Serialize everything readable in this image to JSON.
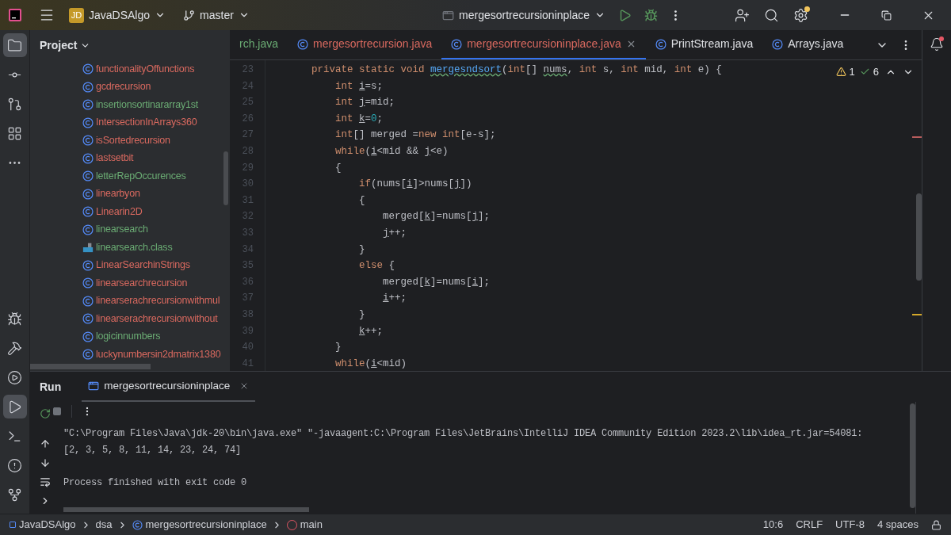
{
  "title_bar": {
    "project_badge": "JD",
    "project": "JavaDSAlgo",
    "branch": "master",
    "run_config": "mergesortrecursioninplace"
  },
  "project_panel": {
    "title": "Project",
    "items": [
      {
        "name": "functionalityOffunctions",
        "kind": "class",
        "color": "#d9695f"
      },
      {
        "name": "gcdrecursion",
        "kind": "class",
        "color": "#d9695f"
      },
      {
        "name": "insertionsortinararray1st",
        "kind": "class",
        "color": "#6aab73"
      },
      {
        "name": "IntersectionInArrays360",
        "kind": "class",
        "color": "#d9695f"
      },
      {
        "name": "isSortedrecursion",
        "kind": "class",
        "color": "#d9695f"
      },
      {
        "name": "lastsetbit",
        "kind": "class",
        "color": "#d9695f"
      },
      {
        "name": "letterRepOccurences",
        "kind": "class",
        "color": "#6aab73"
      },
      {
        "name": "linearbyon",
        "kind": "class",
        "color": "#d9695f"
      },
      {
        "name": "Linearin2D",
        "kind": "class",
        "color": "#d9695f"
      },
      {
        "name": "linearsearch",
        "kind": "class",
        "color": "#6aab73"
      },
      {
        "name": "linearsearch.class",
        "kind": "binary",
        "color": "#6aab73"
      },
      {
        "name": "LinearSearchinStrings",
        "kind": "class",
        "color": "#d9695f"
      },
      {
        "name": "linearsearchrecursion",
        "kind": "class",
        "color": "#d9695f"
      },
      {
        "name": "linearserachrecursionwithmul",
        "kind": "class",
        "color": "#d9695f"
      },
      {
        "name": "linearserachrecursionwithout",
        "kind": "class",
        "color": "#d9695f"
      },
      {
        "name": "logicinnumbers",
        "kind": "class",
        "color": "#6aab73"
      },
      {
        "name": "luckynumbersin2dmatrix1380",
        "kind": "class",
        "color": "#d9695f"
      }
    ]
  },
  "tabs": [
    {
      "label": "rch.java",
      "selected": false,
      "icon": false,
      "color": "#6aab73"
    },
    {
      "label": "mergesortrecursion.java",
      "selected": false,
      "icon": true,
      "color": "#d9695f"
    },
    {
      "label": "mergesortrecursioninplace.java",
      "selected": true,
      "icon": true,
      "color": "#d9695f"
    },
    {
      "label": "PrintStream.java",
      "selected": false,
      "icon": true,
      "color": "#dfe1e5"
    },
    {
      "label": "Arrays.java",
      "selected": false,
      "icon": true,
      "color": "#dfe1e5"
    }
  ],
  "editor": {
    "warnings": "1",
    "checks": "6",
    "lines": [
      {
        "number": "23",
        "tokens": [
          {
            "kind": "kw",
            "text": "    private static void "
          },
          {
            "kind": "decl",
            "text": "mergesndsort"
          },
          {
            "kind": "text",
            "text": "("
          },
          {
            "kind": "kw",
            "text": "int"
          },
          {
            "kind": "text",
            "text": "[] "
          },
          {
            "kind": "warn",
            "text": "nums"
          },
          {
            "kind": "text",
            "text": ", "
          },
          {
            "kind": "kw",
            "text": "int"
          },
          {
            "kind": "text",
            "text": " s, "
          },
          {
            "kind": "kw",
            "text": "int"
          },
          {
            "kind": "text",
            "text": " mid, "
          },
          {
            "kind": "kw",
            "text": "int"
          },
          {
            "kind": "text",
            "text": " e) {"
          }
        ]
      },
      {
        "number": "24",
        "tokens": [
          {
            "kind": "kw",
            "text": "        int "
          },
          {
            "kind": "var",
            "text": "i"
          },
          {
            "kind": "text",
            "text": "=s;"
          }
        ]
      },
      {
        "number": "25",
        "tokens": [
          {
            "kind": "kw",
            "text": "        int "
          },
          {
            "kind": "var",
            "text": "j"
          },
          {
            "kind": "text",
            "text": "=mid;"
          }
        ]
      },
      {
        "number": "26",
        "tokens": [
          {
            "kind": "kw",
            "text": "        int "
          },
          {
            "kind": "var",
            "text": "k"
          },
          {
            "kind": "text",
            "text": "="
          },
          {
            "kind": "num",
            "text": "0"
          },
          {
            "kind": "text",
            "text": ";"
          }
        ]
      },
      {
        "number": "27",
        "tokens": [
          {
            "kind": "kw",
            "text": "        int"
          },
          {
            "kind": "text",
            "text": "[] merged ="
          },
          {
            "kind": "kw",
            "text": "new int"
          },
          {
            "kind": "text",
            "text": "[e-s];"
          }
        ]
      },
      {
        "number": "28",
        "tokens": [
          {
            "kind": "kw",
            "text": "        while"
          },
          {
            "kind": "text",
            "text": "("
          },
          {
            "kind": "var",
            "text": "i"
          },
          {
            "kind": "text",
            "text": "<mid && "
          },
          {
            "kind": "var",
            "text": "j"
          },
          {
            "kind": "text",
            "text": "<e)"
          }
        ]
      },
      {
        "number": "29",
        "tokens": [
          {
            "kind": "text",
            "text": "        {"
          }
        ]
      },
      {
        "number": "30",
        "tokens": [
          {
            "kind": "kw",
            "text": "            if"
          },
          {
            "kind": "text",
            "text": "(nums["
          },
          {
            "kind": "var",
            "text": "i"
          },
          {
            "kind": "text",
            "text": "]>nums["
          },
          {
            "kind": "var",
            "text": "j"
          },
          {
            "kind": "text",
            "text": "])"
          }
        ]
      },
      {
        "number": "31",
        "tokens": [
          {
            "kind": "text",
            "text": "            {"
          }
        ]
      },
      {
        "number": "32",
        "tokens": [
          {
            "kind": "text",
            "text": "                merged["
          },
          {
            "kind": "var",
            "text": "k"
          },
          {
            "kind": "text",
            "text": "]=nums["
          },
          {
            "kind": "var",
            "text": "j"
          },
          {
            "kind": "text",
            "text": "];"
          }
        ]
      },
      {
        "number": "33",
        "tokens": [
          {
            "kind": "var",
            "text": "                j"
          },
          {
            "kind": "text",
            "text": "++;"
          }
        ]
      },
      {
        "number": "34",
        "tokens": [
          {
            "kind": "text",
            "text": "            }"
          }
        ]
      },
      {
        "number": "35",
        "tokens": [
          {
            "kind": "kw",
            "text": "            else"
          },
          {
            "kind": "text",
            "text": " {"
          }
        ]
      },
      {
        "number": "36",
        "tokens": [
          {
            "kind": "text",
            "text": "                merged["
          },
          {
            "kind": "var",
            "text": "k"
          },
          {
            "kind": "text",
            "text": "]=nums["
          },
          {
            "kind": "var",
            "text": "i"
          },
          {
            "kind": "text",
            "text": "];"
          }
        ]
      },
      {
        "number": "37",
        "tokens": [
          {
            "kind": "var",
            "text": "                i"
          },
          {
            "kind": "text",
            "text": "++;"
          }
        ]
      },
      {
        "number": "38",
        "tokens": [
          {
            "kind": "text",
            "text": "            }"
          }
        ]
      },
      {
        "number": "39",
        "tokens": [
          {
            "kind": "var",
            "text": "            k"
          },
          {
            "kind": "text",
            "text": "++;"
          }
        ]
      },
      {
        "number": "40",
        "tokens": [
          {
            "kind": "text",
            "text": "        }"
          }
        ]
      },
      {
        "number": "41",
        "tokens": [
          {
            "kind": "kw",
            "text": "        while"
          },
          {
            "kind": "text",
            "text": "("
          },
          {
            "kind": "var",
            "text": "i"
          },
          {
            "kind": "text",
            "text": "<mid)"
          }
        ]
      }
    ]
  },
  "run_panel": {
    "title": "Run",
    "tab": "mergesortrecursioninplace",
    "output": [
      {
        "kind": "command",
        "text": "\"C:\\Program Files\\Java\\jdk-20\\bin\\java.exe\" \"-javaagent:C:\\Program Files\\JetBrains\\IntelliJ IDEA Community Edition 2023.2\\lib\\idea_rt.jar=54081:"
      },
      {
        "kind": "stdout",
        "text": "[2, 3, 5, 8, 11, 14, 23, 24, 74]"
      },
      {
        "kind": "exit",
        "text": "Process finished with exit code 0"
      }
    ]
  },
  "status_bar": {
    "breadcrumbs": [
      {
        "text": "JavaDSAlgo",
        "kind": "module"
      },
      {
        "text": "dsa",
        "kind": "folder"
      },
      {
        "text": "mergesortrecursioninplace",
        "kind": "class"
      },
      {
        "text": "main",
        "kind": "method"
      }
    ],
    "items": [
      "10:6",
      "CRLF",
      "UTF-8",
      "4 spaces"
    ]
  }
}
